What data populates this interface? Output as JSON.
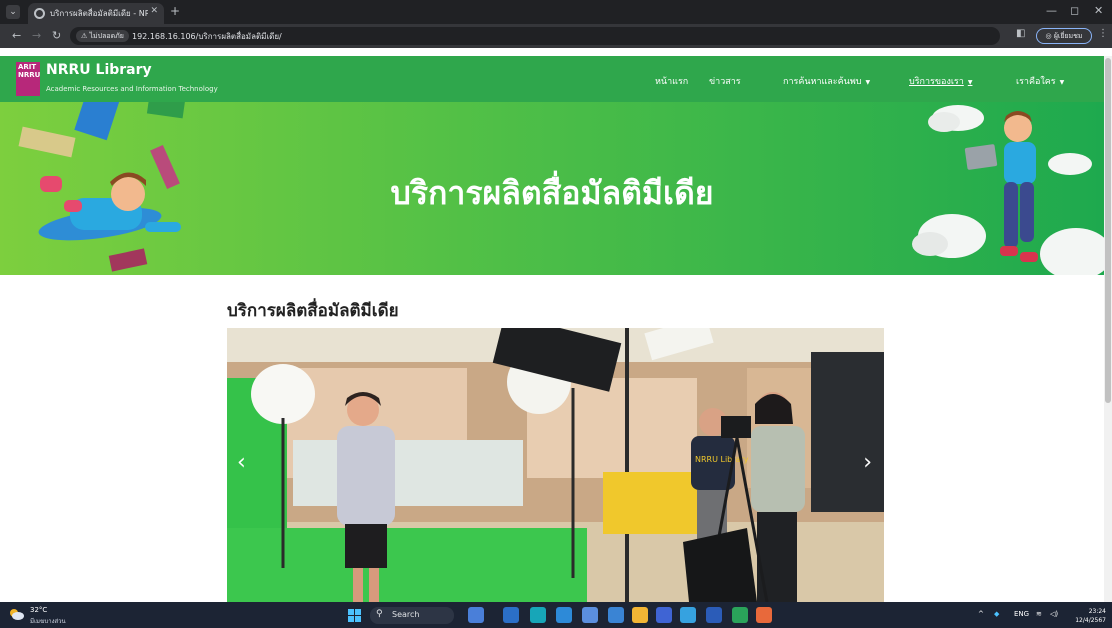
{
  "browser": {
    "tab_title": "บริการผลิตสื่อมัลติมีเดีย - NRRU Li...",
    "security_label": "ไม่ปลอดภัย",
    "url": "192.168.16.106/บริการผลิตสื่อมัลติมีเดีย/",
    "profile_label": "ผู้เยี่ยมชม"
  },
  "site": {
    "logo_text": "ARIT NRRU",
    "brand_title": "NRRU Library",
    "brand_subtitle": "Academic Resources and Information Technology",
    "nav": [
      {
        "label": "หน้าแรก",
        "dropdown": false,
        "active": false
      },
      {
        "label": "ข่าวสาร",
        "dropdown": false,
        "active": false
      },
      {
        "label": "การค้นหาและค้นพบ",
        "dropdown": true,
        "active": false
      },
      {
        "label": "บริการของเรา",
        "dropdown": true,
        "active": true
      },
      {
        "label": "เราคือใคร",
        "dropdown": true,
        "active": false
      }
    ],
    "caret": "▼"
  },
  "hero": {
    "title": "บริการผลิตสื่อมัลติมีเดีย"
  },
  "main": {
    "heading": "บริการผลิตสื่อมัลติมีเดีย",
    "carousel_prev": "‹",
    "carousel_next": "›",
    "shirt_text": "NRRU Library"
  },
  "taskbar": {
    "weather_temp": "32°C",
    "weather_desc": "มีเมฆบางส่วน",
    "search_label": "Search",
    "language": "ENG",
    "time": "23:24",
    "date": "12/4/2567"
  },
  "colors": {
    "nav_green": "#2fa74c",
    "hero_start": "#7dcf3e",
    "hero_end": "#1ea94e",
    "chrome_dark": "#202124"
  }
}
